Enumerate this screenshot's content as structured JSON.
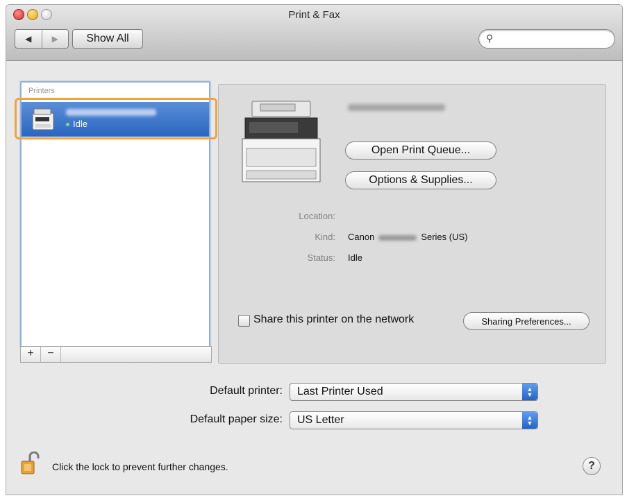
{
  "window": {
    "title": "Print & Fax"
  },
  "toolbar": {
    "back_glyph": "◀",
    "forward_glyph": "▶",
    "show_all_label": "Show All",
    "search_placeholder": "",
    "search_glyph": "⚲"
  },
  "printers": {
    "header": "Printers",
    "items": [
      {
        "status": "Idle"
      }
    ],
    "add_label": "+",
    "remove_label": "−"
  },
  "detail": {
    "open_queue_label": "Open Print Queue...",
    "options_label": "Options & Supplies...",
    "location_label": "Location:",
    "kind_label": "Kind:",
    "kind_prefix": "Canon",
    "kind_suffix": "Series (US)",
    "status_label": "Status:",
    "status_value": "Idle",
    "share_label": "Share this printer on the network",
    "sharing_prefs_label": "Sharing Preferences..."
  },
  "defaults": {
    "printer_label": "Default printer:",
    "printer_value": "Last Printer Used",
    "paper_label": "Default paper size:",
    "paper_value": "US Letter"
  },
  "footer": {
    "lock_text": "Click the lock to prevent further changes.",
    "help_glyph": "?"
  },
  "colors": {
    "selection": "#2a66c0",
    "highlight_outline": "#f2a33a",
    "popup_accent": "#2464c8"
  }
}
